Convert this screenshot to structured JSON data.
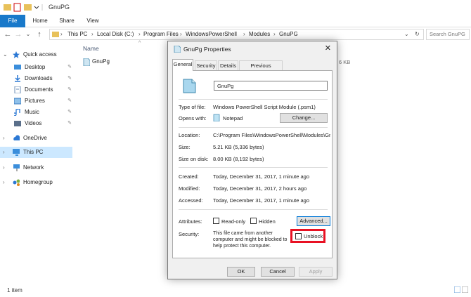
{
  "window": {
    "title": "GnuPG"
  },
  "ribbon": {
    "tabs": [
      "File",
      "Home",
      "Share",
      "View"
    ]
  },
  "address": {
    "crumbs": [
      "This PC",
      "Local Disk (C:)",
      "Program Files",
      "WindowsPowerShell",
      "Modules",
      "GnuPG"
    ],
    "search_placeholder": "Search GnuPG"
  },
  "nav": {
    "quick_access": "Quick access",
    "items": [
      "Desktop",
      "Downloads",
      "Documents",
      "Pictures",
      "Music",
      "Videos"
    ],
    "onedrive": "OneDrive",
    "thispc": "This PC",
    "network": "Network",
    "homegroup": "Homegroup"
  },
  "content": {
    "col_name": "Name",
    "file_name": "GnuPg",
    "size_fragment": "6 KB"
  },
  "status": {
    "items": "1 item"
  },
  "dialog": {
    "title": "GnuPg Properties",
    "tabs": [
      "General",
      "Security",
      "Details",
      "Previous Versions"
    ],
    "filename": "GnuPg",
    "type_label": "Type of file:",
    "type_value": "Windows PowerShell Script Module (.psm1)",
    "opens_label": "Opens with:",
    "opens_value": "Notepad",
    "change_btn": "Change...",
    "location_label": "Location:",
    "location_value": "C:\\Program Files\\WindowsPowerShell\\Modules\\Gnu",
    "size_label": "Size:",
    "size_value": "5.21 KB (5,336 bytes)",
    "sizedisk_label": "Size on disk:",
    "sizedisk_value": "8.00 KB (8,192 bytes)",
    "created_label": "Created:",
    "created_value": "Today, December 31, 2017, 1 minute ago",
    "modified_label": "Modified:",
    "modified_value": "Today, December 31, 2017, 2 hours ago",
    "accessed_label": "Accessed:",
    "accessed_value": "Today, December 31, 2017, 1 minute ago",
    "attributes_label": "Attributes:",
    "readonly_label": "Read-only",
    "hidden_label": "Hidden",
    "advanced_btn": "Advanced...",
    "security_label": "Security:",
    "security_text_1": "This file came from another",
    "security_text_2": "computer and might be blocked to",
    "security_text_3": "help protect this computer.",
    "unblock_label": "Unblock",
    "ok_btn": "OK",
    "cancel_btn": "Cancel",
    "apply_btn": "Apply"
  },
  "colors": {
    "accent": "#1979ca",
    "highlight": "#e81123",
    "selected_nav": "#cce8ff"
  }
}
